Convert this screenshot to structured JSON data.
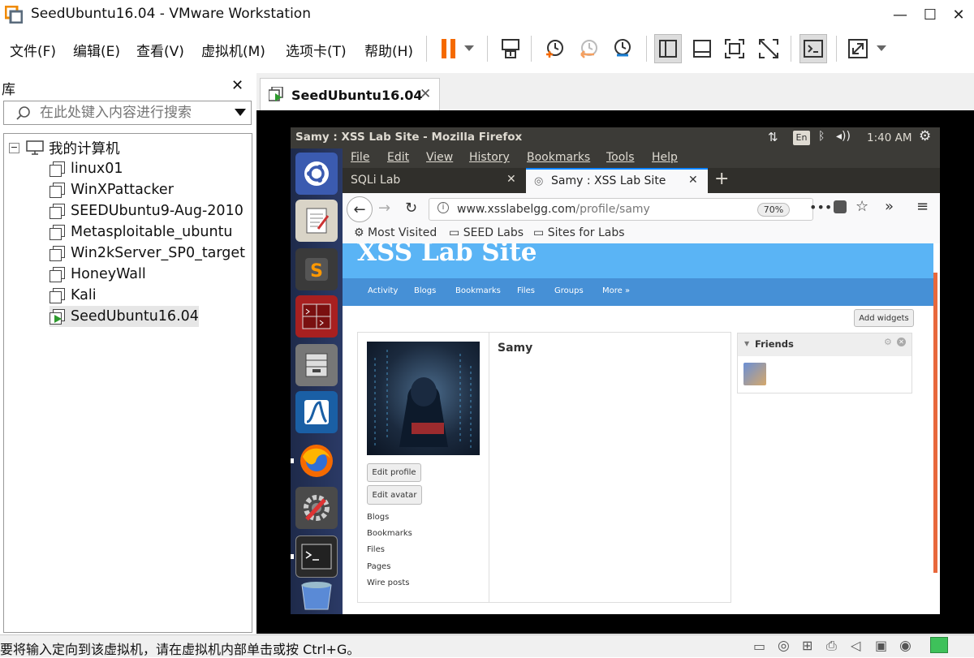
{
  "window": {
    "title": "SeedUbuntu16.04 - VMware Workstation"
  },
  "menu": [
    "文件(F)",
    "编辑(E)",
    "查看(V)",
    "虚拟机(M)",
    "选项卡(T)",
    "帮助(H)"
  ],
  "library": {
    "title": "库",
    "search_placeholder": "在此处键入内容进行搜索",
    "root": "我的计算机",
    "items": [
      "linux01",
      "WinXPattacker",
      "SEEDUbuntu9-Aug-2010",
      "Metasploitable_ubuntu",
      "Win2kServer_SP0_target",
      "HoneyWall",
      "Kali",
      "SeedUbuntu16.04"
    ],
    "selected_index": 7
  },
  "vm_tab": {
    "label": "SeedUbuntu16.04"
  },
  "status_bar": {
    "text": "要将输入定向到该虚拟机，请在虚拟机内部单击或按 Ctrl+G。"
  },
  "guest": {
    "topbar": {
      "title": "Samy : XSS Lab Site - Mozilla Firefox",
      "lang": "En",
      "time": "1:40 AM"
    },
    "firefox": {
      "menu": [
        "File",
        "Edit",
        "View",
        "History",
        "Bookmarks",
        "Tools",
        "Help"
      ],
      "tabs": [
        {
          "label": "SQLi Lab",
          "active": false
        },
        {
          "label": "Samy : XSS Lab Site",
          "active": true
        }
      ],
      "url_host": "www.xsslabelgg.com",
      "url_path": "/profile/samy",
      "zoom": "70%",
      "bookmarks": [
        "Most Visited",
        "SEED Labs",
        "Sites for Labs"
      ]
    },
    "site": {
      "title": "XSS Lab Site",
      "nav": [
        "Activity",
        "Blogs",
        "Bookmarks",
        "Files",
        "Groups",
        "More »"
      ],
      "add_widgets": "Add widgets",
      "profile_name": "Samy",
      "edit_profile": "Edit profile",
      "edit_avatar": "Edit avatar",
      "links": [
        "Blogs",
        "Bookmarks",
        "Files",
        "Pages",
        "Wire posts"
      ],
      "friends_title": "Friends"
    }
  },
  "colors": {
    "accent_orange": "#f56a00",
    "elgg_blue": "#4690d6",
    "elgg_header": "#5ab4f5"
  }
}
